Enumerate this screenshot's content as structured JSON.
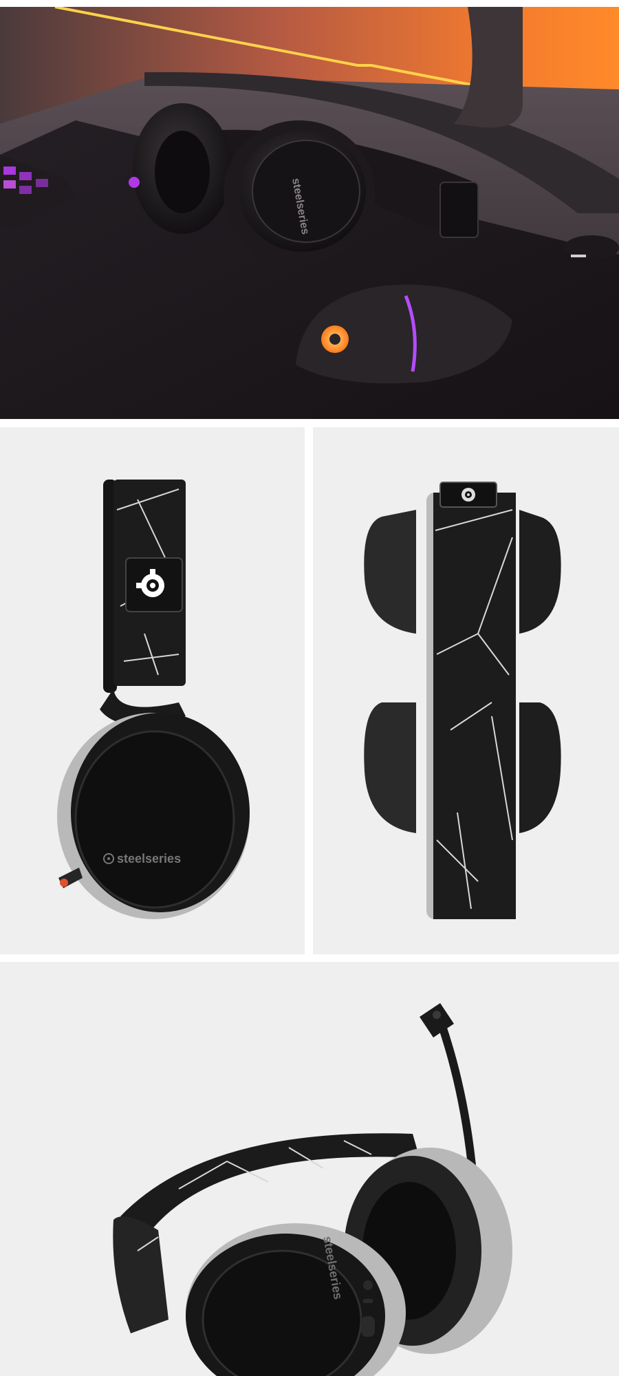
{
  "brand": {
    "wordmark": "steelseries"
  },
  "icons": {
    "logo": "steelseries-logo-icon"
  },
  "colors": {
    "accent_orange": "#ff7a1a",
    "accent_purple": "#c23cff",
    "panel_background": "#efefef",
    "headset_black": "#161616",
    "headset_silver": "#b9b9b9",
    "band_line": "#d8d8d8"
  }
}
